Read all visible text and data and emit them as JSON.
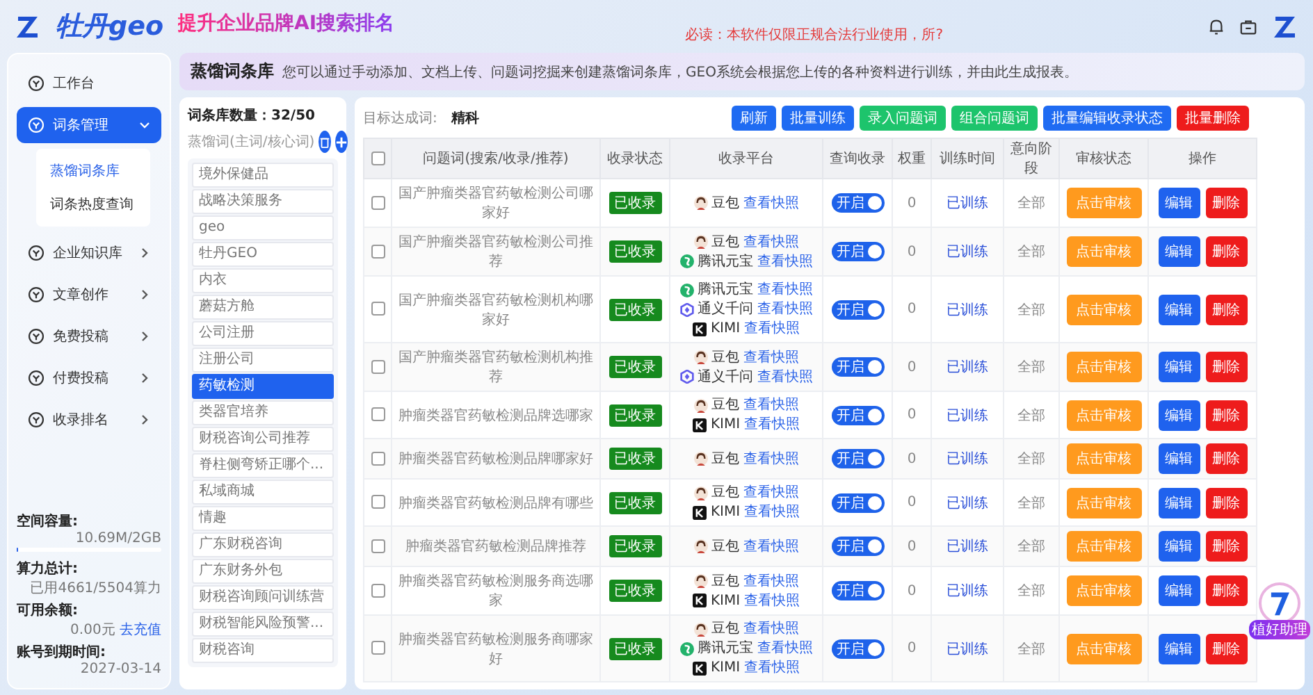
{
  "header": {
    "brand": "牡丹geo",
    "slogan": "提升企业品牌AI搜索排名",
    "notice": "必读：本软件仅限正规合法行业使用，所?"
  },
  "sidebar": {
    "items": [
      {
        "label": "工作台",
        "selected": false
      },
      {
        "label": "词条管理",
        "selected": true,
        "expanded": true,
        "children": [
          {
            "label": "蒸馏词条库",
            "selected": true
          },
          {
            "label": "词条热度查询",
            "selected": false
          }
        ]
      },
      {
        "label": "企业知识库",
        "selected": false,
        "expanded": false
      },
      {
        "label": "文章创作",
        "selected": false,
        "expanded": false
      },
      {
        "label": "免费投稿",
        "selected": false,
        "expanded": false
      },
      {
        "label": "付费投稿",
        "selected": false,
        "expanded": false
      },
      {
        "label": "收录排名",
        "selected": false,
        "expanded": false
      }
    ],
    "stats": [
      {
        "label": "空间容量:",
        "value": "10.69M/2GB",
        "level": 0.01
      },
      {
        "label": "算力总计:",
        "value": "已用4661/5504算力"
      },
      {
        "label": "可用余额:",
        "value": "0.00元",
        "link": "去充值"
      },
      {
        "label": "账号到期时间:",
        "value": "2027-03-14"
      }
    ]
  },
  "banner": {
    "title": "蒸馏词条库",
    "description": "您可以通过手动添加、文档上传、问题词挖掘来创建蒸馏词条库，GEO系统会根据您上传的各种资料进行训练，并由此生成报表。"
  },
  "word_panel": {
    "count_label": "词条库数量：",
    "count": "32/50",
    "label": "蒸馏词(主词/核心词)",
    "words": [
      {
        "text": "境外保健品",
        "selected": false
      },
      {
        "text": "战略决策服务",
        "selected": false
      },
      {
        "text": "geo",
        "selected": false
      },
      {
        "text": "牡丹GEO",
        "selected": false
      },
      {
        "text": "内衣",
        "selected": false
      },
      {
        "text": "蘑菇方舱",
        "selected": false
      },
      {
        "text": "公司注册",
        "selected": false
      },
      {
        "text": "注册公司",
        "selected": false
      },
      {
        "text": "药敏检测",
        "selected": true
      },
      {
        "text": "类器官培养",
        "selected": false
      },
      {
        "text": "财税咨询公司推荐",
        "selected": false
      },
      {
        "text": "脊柱侧弯矫正哪个...",
        "selected": false
      },
      {
        "text": "私域商城",
        "selected": false
      },
      {
        "text": "情趣",
        "selected": false
      },
      {
        "text": "广东财税咨询",
        "selected": false
      },
      {
        "text": "广东财务外包",
        "selected": false
      },
      {
        "text": "财税咨询顾问训练营",
        "selected": false
      },
      {
        "text": "财税智能风险预警...",
        "selected": false
      },
      {
        "text": "财税咨询",
        "selected": false
      }
    ]
  },
  "table_panel": {
    "target_label": "目标达成词:",
    "target_value": "精科",
    "buttons": [
      {
        "label": "刷新",
        "kind": "primary"
      },
      {
        "label": "批量训练",
        "kind": "primary"
      },
      {
        "label": "录入问题词",
        "kind": "success"
      },
      {
        "label": "组合问题词",
        "kind": "success"
      },
      {
        "label": "批量编辑收录状态",
        "kind": "primary"
      },
      {
        "label": "批量删除",
        "kind": "danger"
      }
    ],
    "select_all_checked": false,
    "columns": [
      "问题词(搜索/收录/推荐)",
      "收录状态",
      "收录平台",
      "查询收录",
      "权重",
      "训练时间",
      "意向阶段",
      "审核状态",
      "操作"
    ],
    "rows": [
      {
        "checked": false,
        "question": "国产肿瘤类器官药敏检测公司哪家好",
        "status": "已收录",
        "platforms": [
          {
            "kind": "doubao",
            "name": "豆包",
            "link": "查看快照"
          }
        ],
        "query_on": true,
        "query_label": "开启",
        "weight": "0",
        "training": "已训练",
        "stage": "全部",
        "review": "点击审核",
        "edit": "编辑",
        "delete": "删除"
      },
      {
        "checked": false,
        "question": "国产肿瘤类器官药敏检测公司推荐",
        "status": "已收录",
        "platforms": [
          {
            "kind": "doubao",
            "name": "豆包",
            "link": "查看快照"
          },
          {
            "kind": "yuanbao",
            "name": "腾讯元宝",
            "link": "查看快照"
          }
        ],
        "query_on": true,
        "query_label": "开启",
        "weight": "0",
        "training": "已训练",
        "stage": "全部",
        "review": "点击审核",
        "edit": "编辑",
        "delete": "删除"
      },
      {
        "checked": false,
        "question": "国产肿瘤类器官药敏检测机构哪家好",
        "status": "已收录",
        "platforms": [
          {
            "kind": "yuanbao",
            "name": "腾讯元宝",
            "link": "查看快照"
          },
          {
            "kind": "qwen",
            "name": "通义千问",
            "link": "查看快照"
          },
          {
            "kind": "kimi",
            "name": "KIMI",
            "link": "查看快照"
          }
        ],
        "query_on": true,
        "query_label": "开启",
        "weight": "0",
        "training": "已训练",
        "stage": "全部",
        "review": "点击审核",
        "edit": "编辑",
        "delete": "删除"
      },
      {
        "checked": false,
        "question": "国产肿瘤类器官药敏检测机构推荐",
        "status": "已收录",
        "platforms": [
          {
            "kind": "doubao",
            "name": "豆包",
            "link": "查看快照"
          },
          {
            "kind": "qwen",
            "name": "通义千问",
            "link": "查看快照"
          }
        ],
        "query_on": true,
        "query_label": "开启",
        "weight": "0",
        "training": "已训练",
        "stage": "全部",
        "review": "点击审核",
        "edit": "编辑",
        "delete": "删除"
      },
      {
        "checked": false,
        "question": "肿瘤类器官药敏检测品牌选哪家",
        "status": "已收录",
        "platforms": [
          {
            "kind": "doubao",
            "name": "豆包",
            "link": "查看快照"
          },
          {
            "kind": "kimi",
            "name": "KIMI",
            "link": "查看快照"
          }
        ],
        "query_on": true,
        "query_label": "开启",
        "weight": "0",
        "training": "已训练",
        "stage": "全部",
        "review": "点击审核",
        "edit": "编辑",
        "delete": "删除"
      },
      {
        "checked": false,
        "question": "肿瘤类器官药敏检测品牌哪家好",
        "status": "已收录",
        "platforms": [
          {
            "kind": "doubao",
            "name": "豆包",
            "link": "查看快照"
          }
        ],
        "query_on": true,
        "query_label": "开启",
        "weight": "0",
        "training": "已训练",
        "stage": "全部",
        "review": "点击审核",
        "edit": "编辑",
        "delete": "删除"
      },
      {
        "checked": false,
        "question": "肿瘤类器官药敏检测品牌有哪些",
        "status": "已收录",
        "platforms": [
          {
            "kind": "doubao",
            "name": "豆包",
            "link": "查看快照"
          },
          {
            "kind": "kimi",
            "name": "KIMI",
            "link": "查看快照"
          }
        ],
        "query_on": true,
        "query_label": "开启",
        "weight": "0",
        "training": "已训练",
        "stage": "全部",
        "review": "点击审核",
        "edit": "编辑",
        "delete": "删除"
      },
      {
        "checked": false,
        "question": "肿瘤类器官药敏检测品牌推荐",
        "status": "已收录",
        "platforms": [
          {
            "kind": "doubao",
            "name": "豆包",
            "link": "查看快照"
          }
        ],
        "query_on": true,
        "query_label": "开启",
        "weight": "0",
        "training": "已训练",
        "stage": "全部",
        "review": "点击审核",
        "edit": "编辑",
        "delete": "删除"
      },
      {
        "checked": false,
        "question": "肿瘤类器官药敏检测服务商选哪家",
        "status": "已收录",
        "platforms": [
          {
            "kind": "doubao",
            "name": "豆包",
            "link": "查看快照"
          },
          {
            "kind": "kimi",
            "name": "KIMI",
            "link": "查看快照"
          }
        ],
        "query_on": true,
        "query_label": "开启",
        "weight": "0",
        "training": "已训练",
        "stage": "全部",
        "review": "点击审核",
        "edit": "编辑",
        "delete": "删除"
      },
      {
        "checked": false,
        "question": "肿瘤类器官药敏检测服务商哪家好",
        "status": "已收录",
        "platforms": [
          {
            "kind": "doubao",
            "name": "豆包",
            "link": "查看快照"
          },
          {
            "kind": "yuanbao",
            "name": "腾讯元宝",
            "link": "查看快照"
          },
          {
            "kind": "kimi",
            "name": "KIMI",
            "link": "查看快照"
          }
        ],
        "query_on": true,
        "query_label": "开启",
        "weight": "0",
        "training": "已训练",
        "stage": "全部",
        "review": "点击审核",
        "edit": "编辑",
        "delete": "删除"
      }
    ]
  },
  "assistant": {
    "badge": "植好助理"
  }
}
